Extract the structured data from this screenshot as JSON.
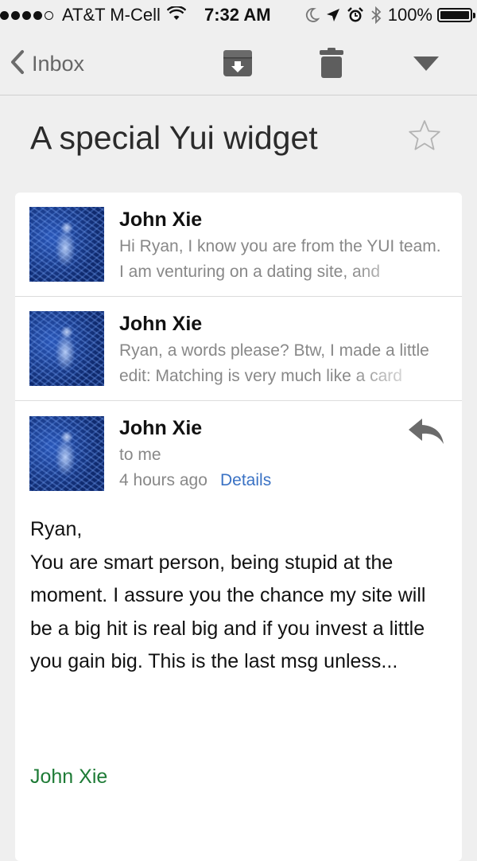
{
  "status_bar": {
    "carrier": "AT&T M-Cell",
    "time": "7:32 AM",
    "battery_percent": "100%",
    "signal_bars": 4,
    "icons": [
      "wifi-icon",
      "moon-icon",
      "location-arrow-icon",
      "alarm-icon",
      "bluetooth-icon",
      "battery-icon"
    ]
  },
  "nav": {
    "back_label": "Inbox",
    "icons": [
      "archive-icon",
      "trash-icon",
      "more-dropdown-icon"
    ]
  },
  "thread": {
    "subject": "A special Yui widget",
    "messages": [
      {
        "sender": "John Xie",
        "snippet": "Hi Ryan, I know you are from the YUI team. I am venturing on a dating site, and"
      },
      {
        "sender": "John Xie",
        "snippet": "Ryan, a words please? Btw, I made a little edit: Matching is very much like a card"
      }
    ],
    "open_message": {
      "sender": "John Xie",
      "to": "to me",
      "time": "4 hours ago",
      "details_label": "Details",
      "body": [
        "Ryan,",
        "You are smart person, being stupid at the moment. I assure you the chance my site will be a big hit is real big and if you invest a little you gain big. This is the last msg unless..."
      ],
      "signature": "John Xie"
    }
  },
  "colors": {
    "link": "#3a72c4",
    "signature": "#1e7b36",
    "background": "#efefef"
  }
}
